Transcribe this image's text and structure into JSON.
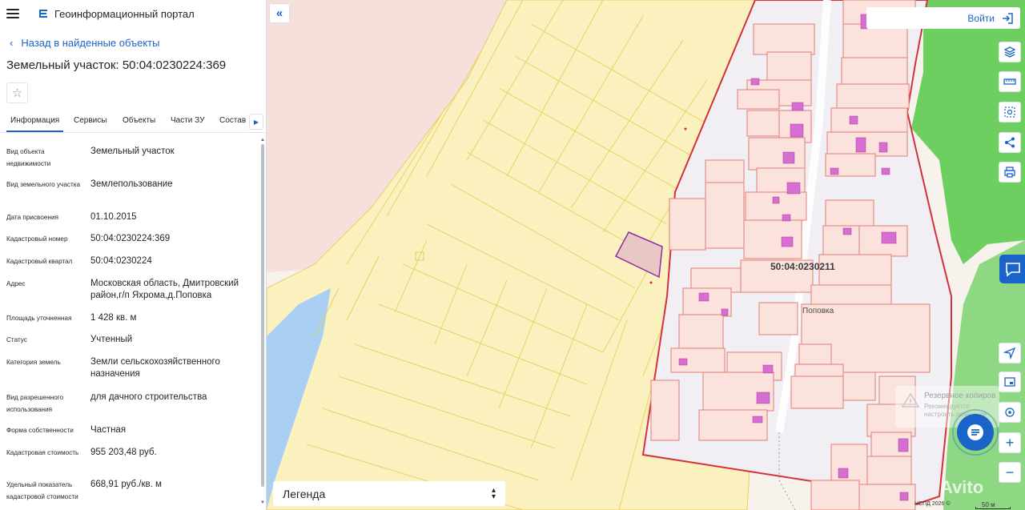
{
  "header": {
    "portal_title": "Геоинформационный портал"
  },
  "nav": {
    "back_label": "Назад в найденные объекты"
  },
  "parcel": {
    "title": "Земельный участок: 50:04:0230224:369"
  },
  "tabs": [
    {
      "label": "Информация",
      "active": true
    },
    {
      "label": "Сервисы",
      "active": false
    },
    {
      "label": "Объекты",
      "active": false
    },
    {
      "label": "Части ЗУ",
      "active": false
    },
    {
      "label": "Состав",
      "active": false
    }
  ],
  "info": [
    {
      "label": "Вид объекта недвижимости",
      "value": "Земельный участок"
    },
    {
      "label": "Вид земельного участка",
      "value": "Землепользование"
    },
    {
      "label": "Дата присвоения",
      "value": "01.10.2015"
    },
    {
      "label": "Кадастровый номер",
      "value": "50:04:0230224:369"
    },
    {
      "label": "Кадастровый квартал",
      "value": "50:04:0230224"
    },
    {
      "label": "Адрес",
      "value": "Московская область, Дмитровский район,г/п Яхрома,д.Поповка"
    },
    {
      "label": "Площадь уточненная",
      "value": "1 428 кв. м"
    },
    {
      "label": "Статус",
      "value": "Учтенный"
    },
    {
      "label": "Категория земель",
      "value": "Земли сельскохозяйственного назначения"
    },
    {
      "label": "Вид разрешенного использования",
      "value": "для дачного строительства"
    },
    {
      "label": "Форма собственности",
      "value": "Частная"
    },
    {
      "label": "Кадастровая стоимость",
      "value": "955 203,48 руб."
    },
    {
      "label": "Удельный показатель кадастровой стоимости",
      "value": "668,91 руб./кв. м"
    }
  ],
  "map": {
    "login_label": "Войти",
    "legend_label": "Легенда",
    "quarter_label": "50:04:0230211",
    "village_label": "Поповка",
    "backup_title": "Резервное копиров",
    "backup_text": "Рекомендуется настроить резервное",
    "copyright": "НСПД 2026 ©",
    "scale": "50 м",
    "watermark": "Avito",
    "tools": [
      "layers-icon",
      "ruler-icon",
      "select-area-icon",
      "share-icon",
      "print-icon"
    ],
    "lower_tools": [
      "locate-icon",
      "minimap-icon",
      "geolocation-icon",
      "zoom-in-icon",
      "zoom-out-icon"
    ]
  },
  "colors": {
    "accent": "#1a64c9",
    "parcel_fill": "#fbe5e0",
    "parcel_stroke": "#e07f72",
    "garden_fill": "#fbf1bf",
    "garden_stroke": "#e9d86e",
    "building": "#d66fd1",
    "boundary": "#d3323b",
    "forest": "#5fc55a",
    "water": "#a9cff2"
  }
}
